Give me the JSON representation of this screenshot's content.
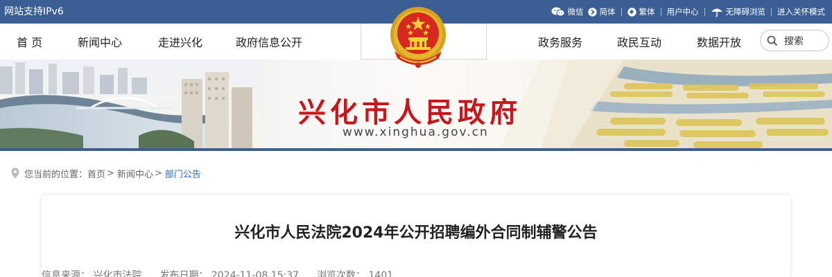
{
  "topbar": {
    "ipv6": "网站支持IPv6",
    "wechat": "微信",
    "simplified": "简体",
    "traditional": "繁体",
    "user_center": "用户中心",
    "accessibility": "无障碍浏览",
    "care_mode": "进入关怀模式"
  },
  "nav": {
    "left": [
      "首 页",
      "新闻中心",
      "走进兴化",
      "政府信息公开"
    ],
    "right": [
      "政务服务",
      "政民互动",
      "数据开放"
    ],
    "search_label": "搜索"
  },
  "banner": {
    "title": "兴化市人民政府",
    "url": "www.xinghua.gov.cn"
  },
  "breadcrumb": {
    "prefix": "您当前的位置：",
    "items": [
      "首页",
      "新闻中心"
    ],
    "current": "部门公告"
  },
  "article": {
    "title": "兴化市人民法院2024年公开招聘编外合同制辅警公告",
    "source": "信息来源：  兴化市法院",
    "date": "发布日期：  2024-11-08 15:37",
    "views": "浏览次数：  1401"
  },
  "colors": {
    "topbar_bg": "#3b5f94",
    "title_red": "#c8161d",
    "link_blue": "#2d6db5"
  }
}
